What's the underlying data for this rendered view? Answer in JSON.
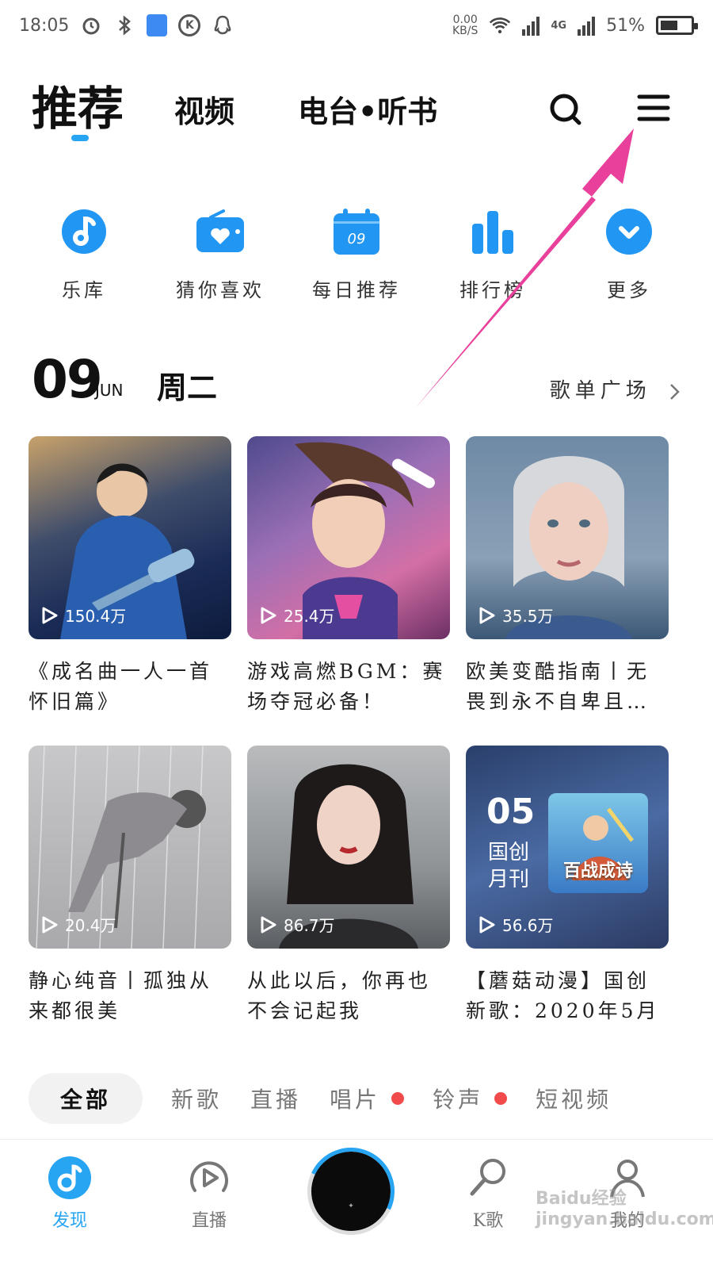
{
  "status_bar": {
    "time": "18:05",
    "net_speed_value": "0.00",
    "net_speed_unit": "KB/S",
    "network_label": "4G",
    "battery": "51%",
    "battery_level": 0.51
  },
  "top_nav": {
    "tabs": [
      {
        "label": "推荐",
        "active": true
      },
      {
        "label": "视频",
        "active": false
      },
      {
        "label": "电台•听书",
        "active": false
      }
    ],
    "accent_color": "#27a4f2"
  },
  "quick_links": [
    {
      "label": "乐库",
      "icon": "music-note-icon"
    },
    {
      "label": "猜你喜欢",
      "icon": "radio-heart-icon"
    },
    {
      "label": "每日推荐",
      "icon": "calendar-icon",
      "badge": "09"
    },
    {
      "label": "排行榜",
      "icon": "bar-chart-icon"
    },
    {
      "label": "更多",
      "icon": "chevron-down-circle-icon"
    }
  ],
  "date_header": {
    "day": "09",
    "month": "JUN",
    "weekday": "周二",
    "playlist_link": "歌单广场"
  },
  "playlists": [
    {
      "title": "《成名曲一人一首怀旧篇》",
      "plays": "150.4万"
    },
    {
      "title": "游戏高燃BGM：赛场夺冠必备！",
      "plays": "25.4万"
    },
    {
      "title": "欧美变酷指南丨无畏到永不自卑且…",
      "plays": "35.5万"
    },
    {
      "title": "静心纯音丨孤独从来都很美",
      "plays": "20.4万"
    },
    {
      "title": "从此以后，你再也不会记起我",
      "plays": "86.7万"
    },
    {
      "title": "【蘑菇动漫】国创新歌：2020年5月刊",
      "plays": "56.6万",
      "cover_badge_num": "05",
      "cover_badge_text": "国创\n月刊",
      "cover_game_title": "百战成诗"
    }
  ],
  "filter_chips": [
    {
      "label": "全部",
      "active": true,
      "dot": false
    },
    {
      "label": "新歌",
      "active": false,
      "dot": false
    },
    {
      "label": "直播",
      "active": false,
      "dot": false
    },
    {
      "label": "唱片",
      "active": false,
      "dot": true
    },
    {
      "label": "铃声",
      "active": false,
      "dot": true
    },
    {
      "label": "短视频",
      "active": false,
      "dot": false
    }
  ],
  "bottom_nav": [
    {
      "label": "发现",
      "active": true
    },
    {
      "label": "直播",
      "active": false
    },
    {
      "label": "K歌",
      "active": false
    },
    {
      "label": "我的",
      "active": false
    }
  ],
  "watermark": "Baidu经验 jingyan.baidu.com",
  "annotation_color": "#e8409b"
}
